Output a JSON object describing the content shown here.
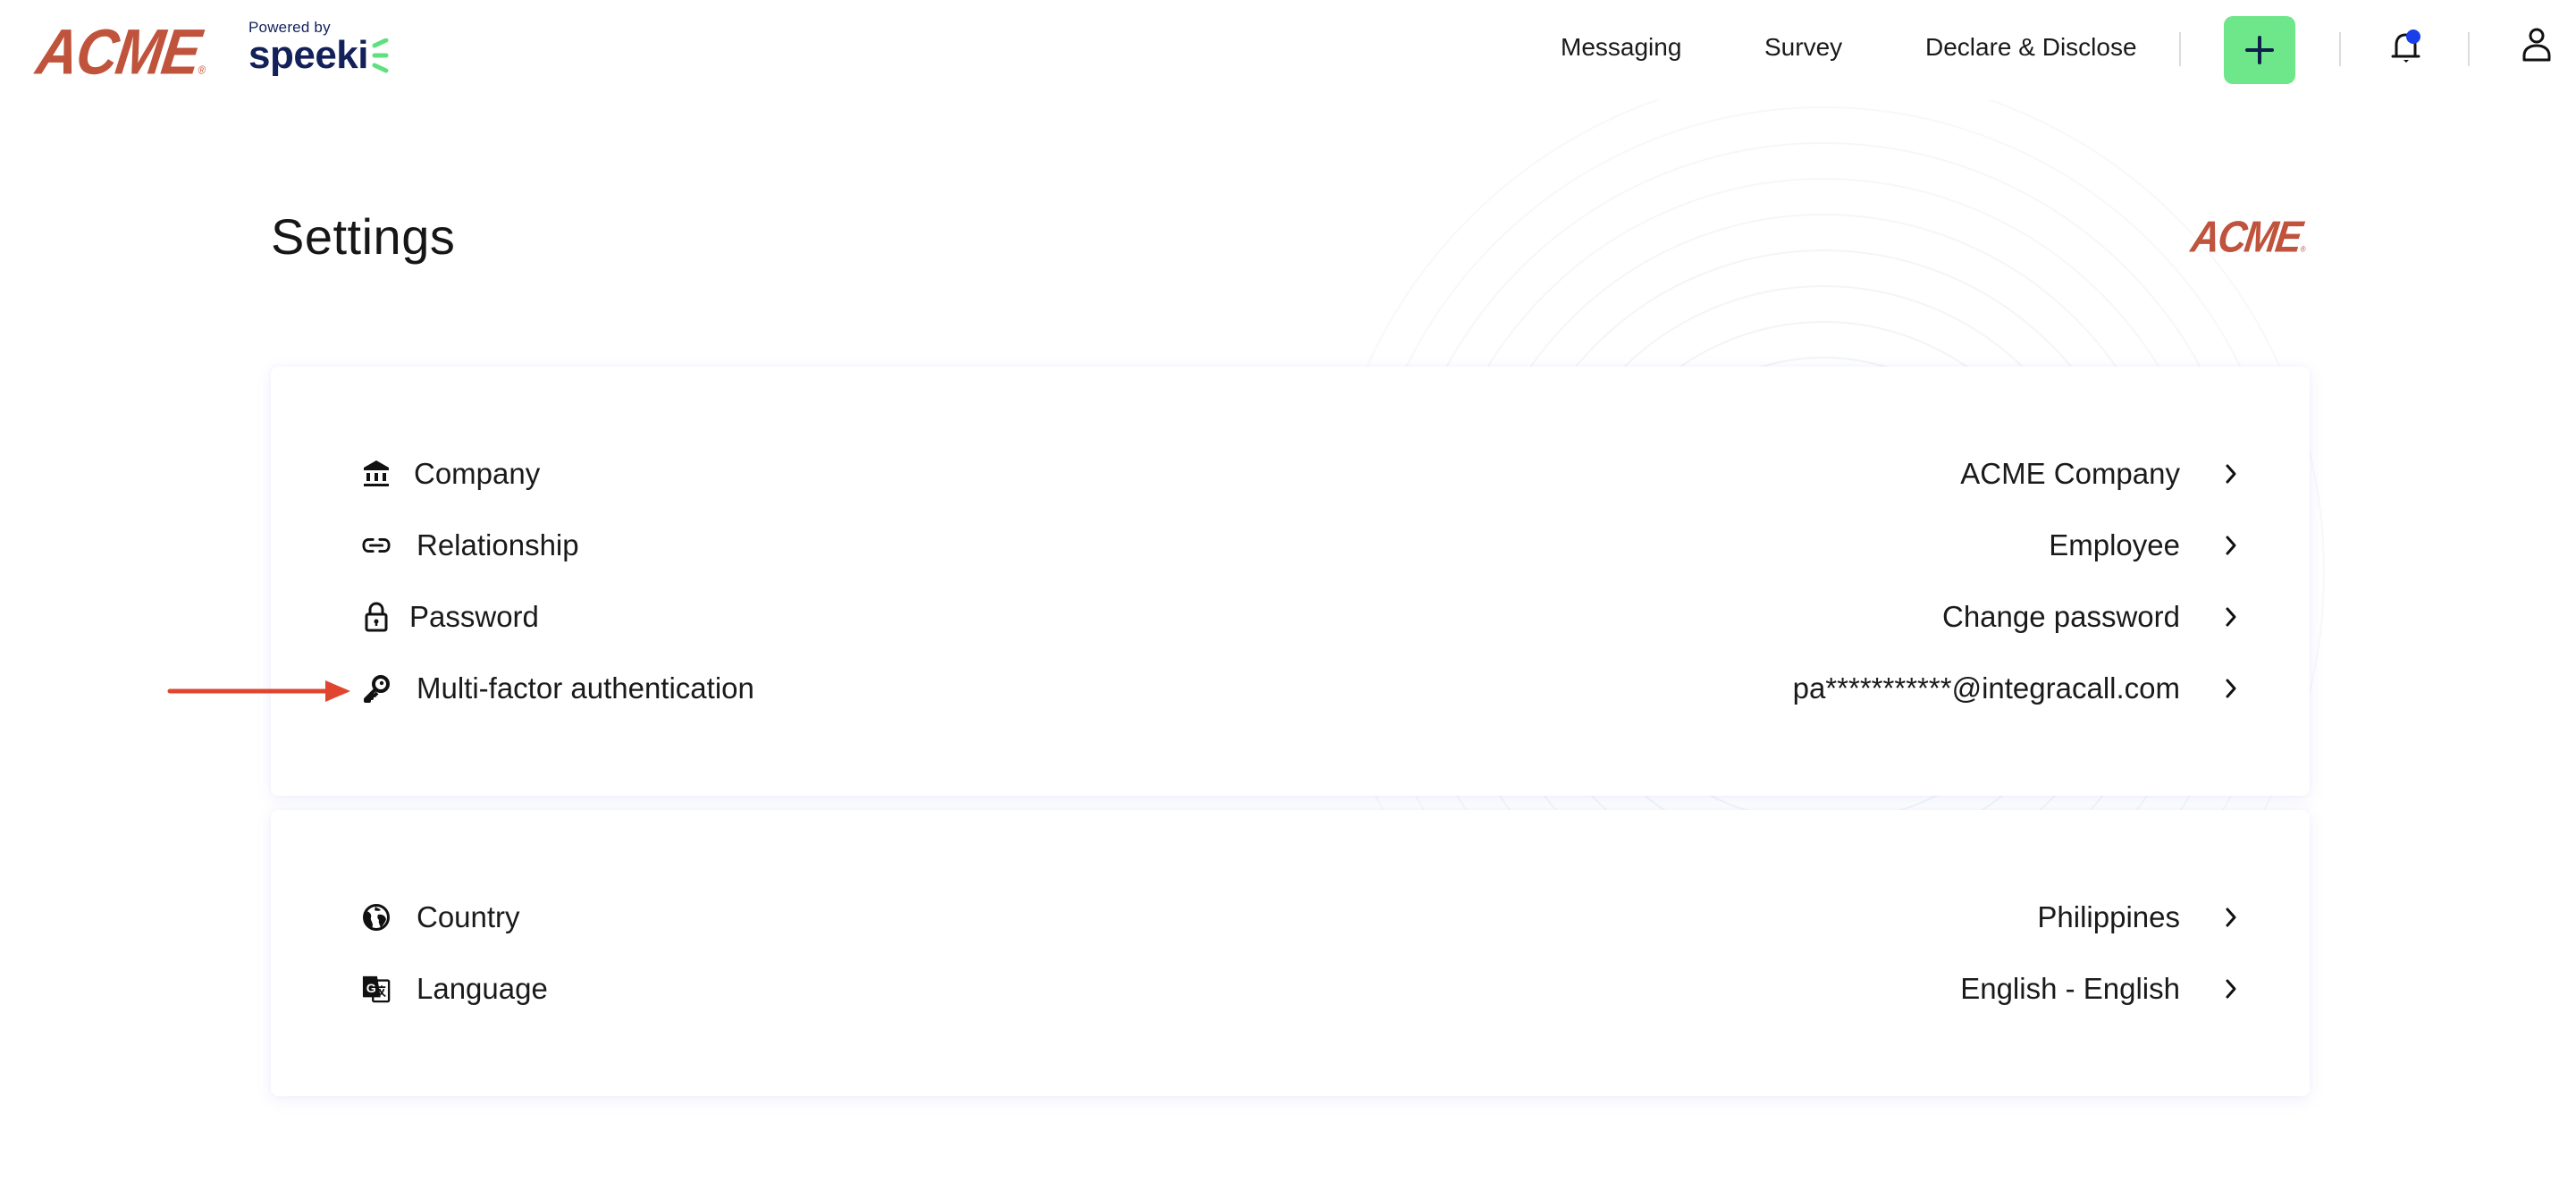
{
  "header": {
    "brand_logo": "ACME",
    "brand_registered": "®",
    "powered_by": "Powered by",
    "partner_logo": "speeki",
    "nav": [
      {
        "label": "Messaging"
      },
      {
        "label": "Survey"
      },
      {
        "label": "Declare & Disclose"
      }
    ],
    "add_button_icon": "plus-icon",
    "notification_icon": "bell-icon",
    "notification_badge": true,
    "account_icon": "user-icon"
  },
  "page": {
    "title": "Settings",
    "company_logo": "ACME",
    "company_logo_registered": "®"
  },
  "settings_groups": [
    {
      "rows": [
        {
          "icon": "bank-icon",
          "label": "Company",
          "value": "ACME Company"
        },
        {
          "icon": "link-icon",
          "label": "Relationship",
          "value": "Employee"
        },
        {
          "icon": "lock-icon",
          "label": "Password",
          "value": "Change password"
        },
        {
          "icon": "key-icon",
          "label": "Multi-factor authentication",
          "value": "pa***********@integracall.com"
        }
      ]
    },
    {
      "rows": [
        {
          "icon": "globe-icon",
          "label": "Country",
          "value": "Philippines"
        },
        {
          "icon": "translate-icon",
          "label": "Language",
          "value": "English - English"
        }
      ]
    }
  ],
  "annotation": {
    "type": "arrow",
    "target": "Multi-factor authentication",
    "color": "#e0452f"
  },
  "colors": {
    "brand_red": "#c0533c",
    "accent_green": "#6ee68a",
    "navy": "#13215a",
    "badge_blue": "#1a3ee8"
  }
}
